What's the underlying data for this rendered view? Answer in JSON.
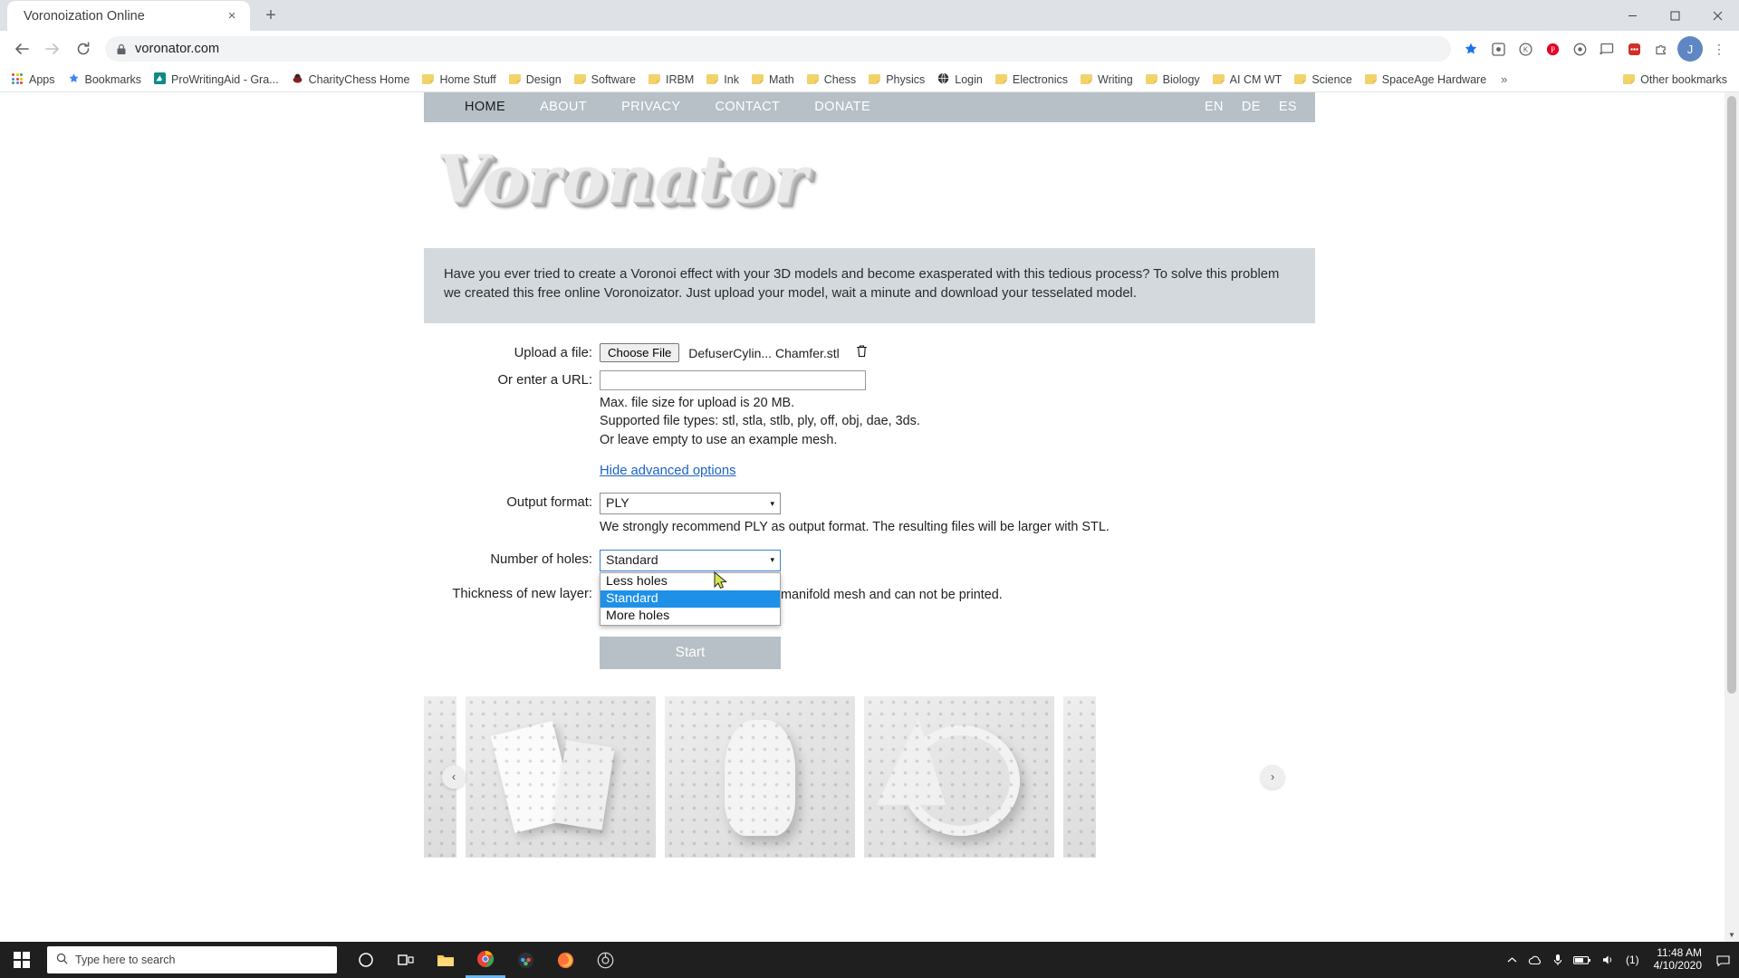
{
  "browser": {
    "tab": {
      "title": "Voronoization Online",
      "close_label": "×"
    },
    "newtab_label": "+",
    "window_controls": {
      "minimize": "—",
      "maximize": "☐",
      "close": "✕"
    },
    "nav": {
      "back": "←",
      "forward": "→",
      "reload": "↻"
    },
    "omnibox": {
      "url": "voronator.com",
      "lock_icon": "lock-icon"
    },
    "toolbar_icons": [
      "star-icon",
      "extension-icon",
      "kiwi-icon",
      "pinterest-icon",
      "circle-icon",
      "cast-icon",
      "lastpass-icon",
      "puzzle-icon"
    ],
    "profile_initial": "J",
    "menu_label": "⋮",
    "bookmarks": [
      {
        "label": "Apps",
        "icon": "apps-grid-icon"
      },
      {
        "label": "Bookmarks",
        "icon": "star-icon"
      },
      {
        "label": "ProWritingAid - Gra...",
        "icon": "prowritingaid-icon"
      },
      {
        "label": "CharityChess Home",
        "icon": "charitychess-icon"
      },
      {
        "label": "Home Stuff",
        "icon": "folder-icon"
      },
      {
        "label": "Design",
        "icon": "folder-icon"
      },
      {
        "label": "Software",
        "icon": "folder-icon"
      },
      {
        "label": "IRBM",
        "icon": "folder-icon"
      },
      {
        "label": "Ink",
        "icon": "folder-icon"
      },
      {
        "label": "Math",
        "icon": "folder-icon"
      },
      {
        "label": "Chess",
        "icon": "folder-icon"
      },
      {
        "label": "Physics",
        "icon": "folder-icon"
      },
      {
        "label": "Login",
        "icon": "globe-icon"
      },
      {
        "label": "Electronics",
        "icon": "folder-icon"
      },
      {
        "label": "Writing",
        "icon": "folder-icon"
      },
      {
        "label": "Biology",
        "icon": "folder-icon"
      },
      {
        "label": "AI CM WT",
        "icon": "folder-icon"
      },
      {
        "label": "Science",
        "icon": "folder-icon"
      },
      {
        "label": "SpaceAge Hardware",
        "icon": "folder-icon"
      }
    ],
    "bookmarks_overflow": "»",
    "other_bookmarks": {
      "label": "Other bookmarks",
      "icon": "folder-icon"
    }
  },
  "site": {
    "nav": [
      {
        "label": "HOME",
        "active": true
      },
      {
        "label": "ABOUT",
        "active": false
      },
      {
        "label": "PRIVACY",
        "active": false
      },
      {
        "label": "CONTACT",
        "active": false
      },
      {
        "label": "DONATE",
        "active": false
      }
    ],
    "languages": [
      "EN",
      "DE",
      "ES"
    ],
    "logo_text": "Voronator",
    "intro": "Have you ever tried to create a Voronoi effect with your 3D models and become exasperated with this tedious process? To solve this problem we created this free online Voronoizator. Just upload your model, wait a minute and download your tesselated model."
  },
  "form": {
    "upload_label": "Upload a file:",
    "choose_file_button": "Choose File",
    "chosen_file": "DefuserCylin... Chamfer.stl",
    "delete_icon": "trash-icon",
    "url_label": "Or enter a URL:",
    "url_value": "",
    "url_placeholder": "",
    "hints": [
      "Max. file size for upload is 20 MB.",
      "Supported file types: stl, stla, stlb, ply, off, obj, dae, 3ds.",
      "Or leave empty to use an example mesh."
    ],
    "advanced_link": "Hide advanced options",
    "output_format_label": "Output format:",
    "output_format_value": "PLY",
    "output_format_note": "We strongly recommend PLY as output format. The resulting files will be larger with STL.",
    "holes_label": "Number of holes:",
    "holes_value": "Standard",
    "holes_options": [
      "Less holes",
      "Standard",
      "More holes"
    ],
    "holes_selected_index": 1,
    "thickness_label": "Thickness of new layer:",
    "thickness_note_tail": "manifold mesh and can not be printed.",
    "start_button": "Start",
    "caret": "▾"
  },
  "gallery": {
    "prev_label": "‹",
    "next_label": "›"
  },
  "taskbar": {
    "search_placeholder": "Type here to search",
    "search_icon": "magnifier-icon",
    "items": [
      {
        "name": "cortana-icon"
      },
      {
        "name": "task-view-icon"
      },
      {
        "name": "file-explorer-icon"
      },
      {
        "name": "chrome-icon"
      },
      {
        "name": "discord-icon"
      },
      {
        "name": "firefox-icon"
      },
      {
        "name": "settings-icon"
      }
    ],
    "tray": {
      "chevron": "˄",
      "cloud_icon": "cloud-icon",
      "mic_icon": "microphone-icon",
      "battery_icon": "battery-icon",
      "volume_icon": "volume-icon",
      "network_label": "(1)",
      "time": "11:48 AM",
      "date": "4/10/2020",
      "notification_icon": "notification-icon"
    }
  },
  "colors": {
    "site_nav_bg": "#b6c0c6",
    "intro_bg": "#d3d9dd",
    "link": "#1b62c8",
    "dropdown_highlight": "#1e90e8",
    "start_btn": "#b6c0c6"
  }
}
